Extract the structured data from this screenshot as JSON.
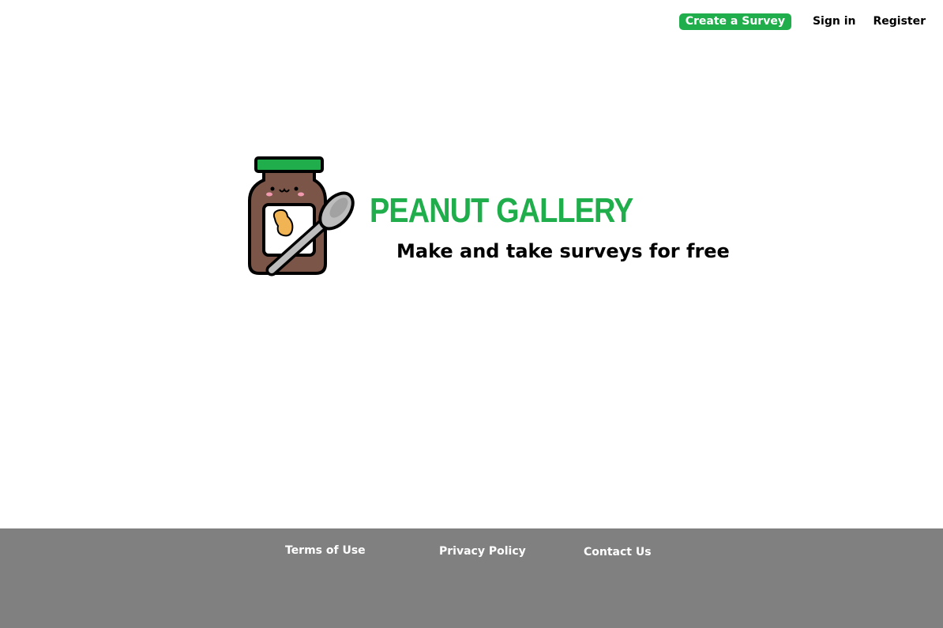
{
  "nav": {
    "create_label": "Create a Survey",
    "signin_label": "Sign in",
    "register_label": "Register"
  },
  "brand": {
    "title": "PEANUT GALLERY",
    "tagline": "Make and take surveys for free",
    "logo_icon": "peanut-butter-jar-icon"
  },
  "footer": {
    "terms_label": "Terms of Use",
    "privacy_label": "Privacy Policy",
    "contact_label": "Contact Us"
  },
  "colors": {
    "accent": "#1fae4b",
    "footer_bg": "#808080",
    "jar_body": "#7a5548",
    "jar_lid": "#1fae4b",
    "peanut": "#f0b454",
    "spoon": "#bdbdbd"
  }
}
